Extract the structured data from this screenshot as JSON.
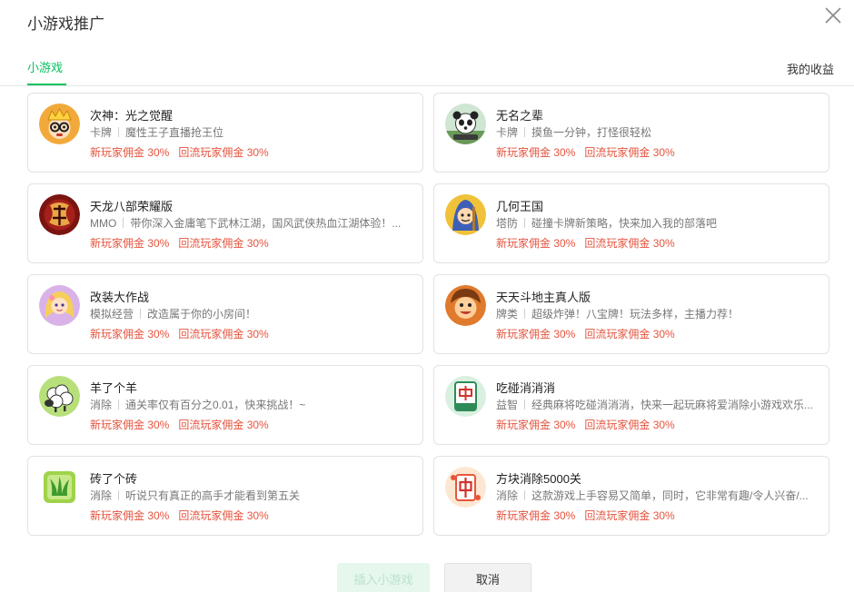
{
  "dialog": {
    "title": "小游戏推广"
  },
  "tabs": {
    "active": "小游戏",
    "right_link": "我的收益"
  },
  "colors": {
    "accent": "#07c160",
    "commission": "#e5533d"
  },
  "games": [
    {
      "name": "次神：光之觉醒",
      "category": "卡牌",
      "desc": "魔性王子直播抢王位",
      "new_commission": "新玩家佣金 30%",
      "return_commission": "回流玩家佣金 30%",
      "icon": "crowned-character-icon"
    },
    {
      "name": "无名之辈",
      "category": "卡牌",
      "desc": "摸鱼一分钟，打怪很轻松",
      "new_commission": "新玩家佣金 30%",
      "return_commission": "回流玩家佣金 30%",
      "icon": "panda-warrior-icon"
    },
    {
      "name": "天龙八部荣耀版",
      "category": "MMO",
      "desc": "带你深入金庸笔下武林江湖，国风武侠热血江湖体验！...",
      "new_commission": "新玩家佣金 30%",
      "return_commission": "回流玩家佣金 30%",
      "icon": "dragon-calligraphy-icon"
    },
    {
      "name": "几何王国",
      "category": "塔防",
      "desc": "碰撞卡牌新策略，快来加入我的部落吧",
      "new_commission": "新玩家佣金 30%",
      "return_commission": "回流玩家佣金 30%",
      "icon": "hooded-knight-icon"
    },
    {
      "name": "改装大作战",
      "category": "模拟经营",
      "desc": "改造属于你的小房间！",
      "new_commission": "新玩家佣金 30%",
      "return_commission": "回流玩家佣金 30%",
      "icon": "blonde-girl-icon"
    },
    {
      "name": "天天斗地主真人版",
      "category": "牌类",
      "desc": "超级炸弹！八宝牌！玩法多样，主播力荐！",
      "new_commission": "新玩家佣金 30%",
      "return_commission": "回流玩家佣金 30%",
      "icon": "cartoon-boy-icon"
    },
    {
      "name": "羊了个羊",
      "category": "消除",
      "desc": "通关率仅有百分之0.01，快来挑战！~",
      "new_commission": "新玩家佣金 30%",
      "return_commission": "回流玩家佣金 30%",
      "icon": "sheep-icon"
    },
    {
      "name": "吃碰消消消",
      "category": "益智",
      "desc": "经典麻将吃碰消消消，快来一起玩麻将爱消除小游戏欢乐...",
      "new_commission": "新玩家佣金 30%",
      "return_commission": "回流玩家佣金 30%",
      "icon": "mahjong-tile-icon"
    },
    {
      "name": "砖了个砖",
      "category": "消除",
      "desc": "听说只有真正的高手才能看到第五关",
      "new_commission": "新玩家佣金 30%",
      "return_commission": "回流玩家佣金 30%",
      "icon": "grass-tile-icon"
    },
    {
      "name": "方块消除5000关",
      "category": "消除",
      "desc": "这款游戏上手容易又简单，同时，它非常有趣/令人兴奋/...",
      "new_commission": "新玩家佣金 30%",
      "return_commission": "回流玩家佣金 30%",
      "icon": "zhong-tile-icon"
    }
  ],
  "footer": {
    "insert_label": "插入小游戏",
    "cancel_label": "取消"
  }
}
